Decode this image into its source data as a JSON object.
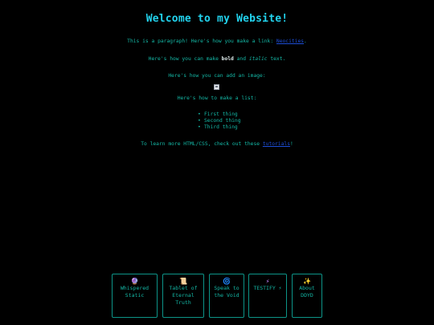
{
  "page": {
    "title": "Welcome to my Website!"
  },
  "paragraphs": {
    "link_line_prefix": "This is a paragraph! Here's how you make a link: ",
    "link_line_link": "Neocities",
    "link_line_suffix": ".",
    "format_line_prefix": "Here's how you can make ",
    "format_bold": "bold",
    "format_middle": " and ",
    "format_italic": "italic",
    "format_suffix": " text.",
    "image_line": "Here's how you can add an image:",
    "list_line": "Here's how to make a list:",
    "learn_prefix": "To learn more HTML/CSS, check out these ",
    "learn_link": "tutorials",
    "learn_suffix": "!"
  },
  "list": {
    "items": [
      "First thing",
      "Second thing",
      "Third thing"
    ]
  },
  "nav": {
    "items": [
      {
        "icon": "🔮",
        "label": "Whispered Static"
      },
      {
        "icon": "📜",
        "label": "Tablet of Eternal Truth"
      },
      {
        "icon": "🌀",
        "label": "Speak to the Void"
      },
      {
        "icon": "⚡",
        "label": "TESTIFY ⚡"
      },
      {
        "icon": "✨",
        "label": "About DDYD"
      }
    ]
  },
  "colors": {
    "background": "#000000",
    "title": "#22d3ee",
    "text": "#14b8a6",
    "link": "#1d4ed8",
    "border": "#0d9488"
  }
}
